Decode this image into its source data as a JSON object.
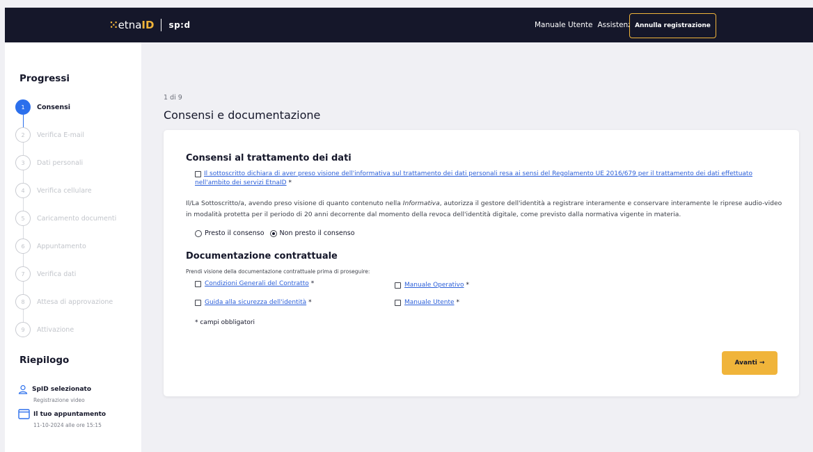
{
  "header": {
    "logo_etna": "etna",
    "logo_id": "ID",
    "logo_spid": "sp:d",
    "nav": [
      {
        "label": "Manuale Utente"
      },
      {
        "label": "Assistenza"
      }
    ],
    "cancel_label": "Annulla registrazione"
  },
  "sidebar": {
    "progress_title": "Progressi",
    "steps": [
      {
        "num": "1",
        "label": "Consensi",
        "active": true
      },
      {
        "num": "2",
        "label": "Verifica E-mail",
        "active": false
      },
      {
        "num": "3",
        "label": "Dati personali",
        "active": false
      },
      {
        "num": "4",
        "label": "Verifica cellulare",
        "active": false
      },
      {
        "num": "5",
        "label": "Caricamento documenti",
        "active": false
      },
      {
        "num": "6",
        "label": "Appuntamento",
        "active": false
      },
      {
        "num": "7",
        "label": "Verifica dati",
        "active": false
      },
      {
        "num": "8",
        "label": "Attesa di approvazione",
        "active": false
      },
      {
        "num": "9",
        "label": "Attivazione",
        "active": false
      }
    ],
    "summary_title": "Riepilogo",
    "summary": [
      {
        "icon": "user-icon",
        "title": "SpID selezionato",
        "sub": "Registrazione video"
      },
      {
        "icon": "calendar-icon",
        "title": "Il tuo appuntamento",
        "sub": "11-10-2024 alle ore 15:15"
      }
    ]
  },
  "main": {
    "counter": "1 di 9",
    "title": "Consensi e documentazione",
    "section1_title": "Consensi al trattamento dei dati",
    "consent_link": "Il sottoscritto dichiara di aver preso visione dell'informativa sul trattamento dei dati personali resa ai sensi del Regolamento UE 2016/679 per il trattamento dei dati effettuato nell'ambito dei servizi EtnaID",
    "required_mark": "*",
    "paragraph_before": "Il/La Sottoscritto/a, avendo preso visione di quanto contenuto nella ",
    "paragraph_italic": "Informativa",
    "paragraph_after": ", autorizza il gestore dell'identità a registrare interamente e conservare interamente le riprese audio-video in modalità protetta per il periodo di 20 anni decorrente dal momento della revoca dell'identità digitale, come previsto dalla normativa vigente in materia.",
    "radio_options": [
      {
        "label": "Presto il consenso",
        "selected": false
      },
      {
        "label": "Non presto il consenso",
        "selected": true
      }
    ],
    "section2_title": "Documentazione contrattuale",
    "doc_intro": "Prendi visione della documentazione contrattuale prima di proseguire:",
    "docs": [
      {
        "label": "Condizioni Generali del Contratto"
      },
      {
        "label": "Manuale Operativo"
      },
      {
        "label": "Guida alla sicurezza dell'identità"
      },
      {
        "label": "Manuale Utente"
      }
    ],
    "required_note": "* campi obbligatori",
    "next_label": "Avanti →"
  }
}
